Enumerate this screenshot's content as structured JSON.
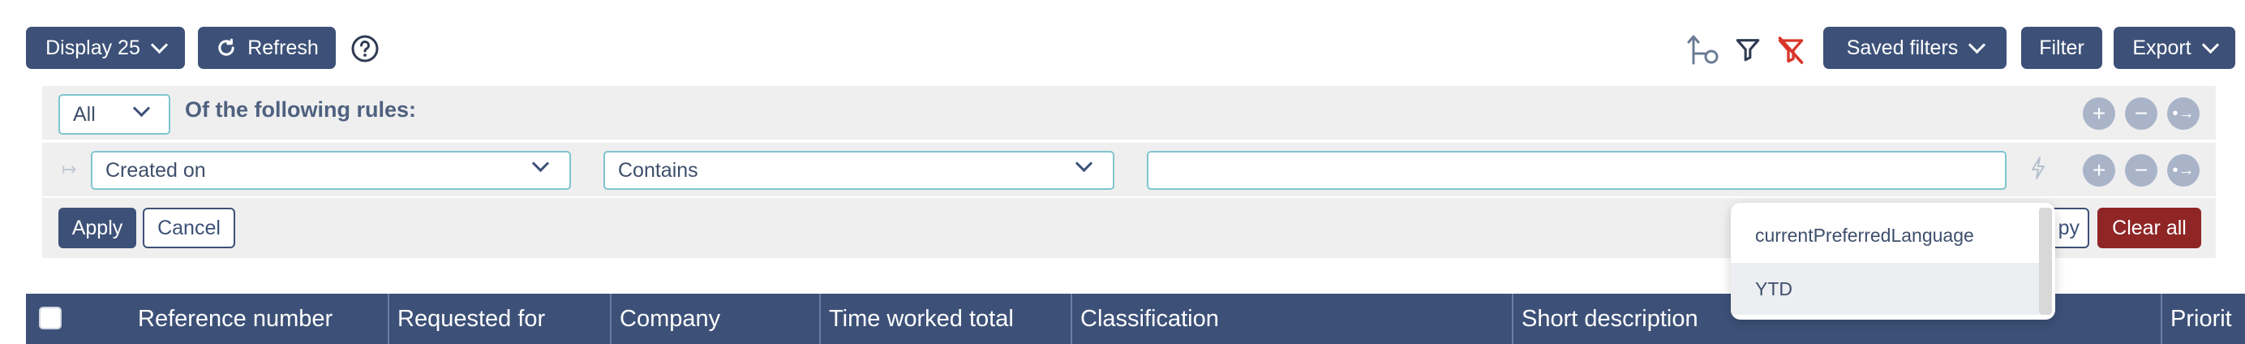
{
  "toolbar": {
    "display_label": "Display 25",
    "refresh_label": "Refresh",
    "saved_filters_label": "Saved filters",
    "filter_label": "Filter",
    "export_label": "Export"
  },
  "rules": {
    "match_value": "All",
    "match_text": "Of the following rules:",
    "field_value": "Created on",
    "operator_value": "Contains",
    "value_input": ""
  },
  "actions": {
    "apply_label": "Apply",
    "cancel_label": "Cancel",
    "hidden_button_partial": "py",
    "clear_all_label": "Clear all"
  },
  "dropdown": {
    "items": [
      "currentPreferredLanguage",
      "YTD"
    ]
  },
  "table": {
    "columns": [
      "Reference number",
      "Requested for",
      "Company",
      "Time worked total",
      "Classification",
      "Short description",
      "Priorit"
    ]
  },
  "colors": {
    "primary": "#3d5178",
    "danger": "#8f2525",
    "accent_border": "#7fc5cf",
    "panel_bg": "#efefef",
    "filter_clear_icon": "#d9362b"
  }
}
